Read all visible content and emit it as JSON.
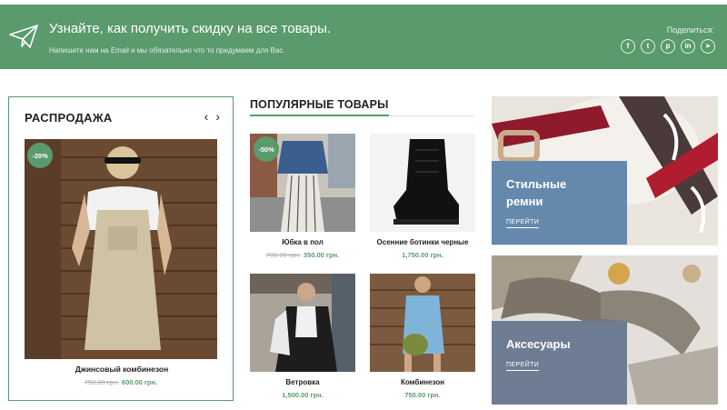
{
  "banner": {
    "title": "Узнайте, как получить скидку на все товары.",
    "subtitle": "Напишите нам на Email и мы обязательно что то придумаем для Вас.",
    "share_label": "Поделиться:",
    "socials": [
      {
        "icon": "facebook-icon",
        "glyph": "f"
      },
      {
        "icon": "twitter-icon",
        "glyph": "t"
      },
      {
        "icon": "pinterest-icon",
        "glyph": "p"
      },
      {
        "icon": "linkedin-icon",
        "glyph": "in"
      },
      {
        "icon": "telegram-icon",
        "glyph": "➤"
      }
    ]
  },
  "sale": {
    "title": "РАСПРОДАЖА",
    "prev": "‹",
    "next": "›",
    "badge": "-20%",
    "product_name": "Джинсовый комбинезон",
    "old_price": "750.00 грн.",
    "new_price": "600.00 грн."
  },
  "popular": {
    "title": "ПОПУЛЯРНЫЕ ТОВАРЫ",
    "products": [
      {
        "name": "Юбка в пол",
        "badge": "-50%",
        "old_price": "700.00 грн.",
        "price": "350.00 грн."
      },
      {
        "name": "Осенние ботинки черные",
        "price": "1,750.00 грн."
      },
      {
        "name": "Ветровка",
        "price": "1,500.00 грн."
      },
      {
        "name": "Комбинезон",
        "price": "750.00 грн."
      }
    ]
  },
  "promos": [
    {
      "title_line1": "Стильные",
      "title_line2": "ремни",
      "link": "ПЕРЕЙТИ"
    },
    {
      "title_line1": "Аксесуары",
      "link": "ПЕРЕЙТИ"
    }
  ],
  "colors": {
    "accent": "#5a9a6d",
    "promo_blue": "#6489ac",
    "promo_slate": "#6e7d94"
  }
}
